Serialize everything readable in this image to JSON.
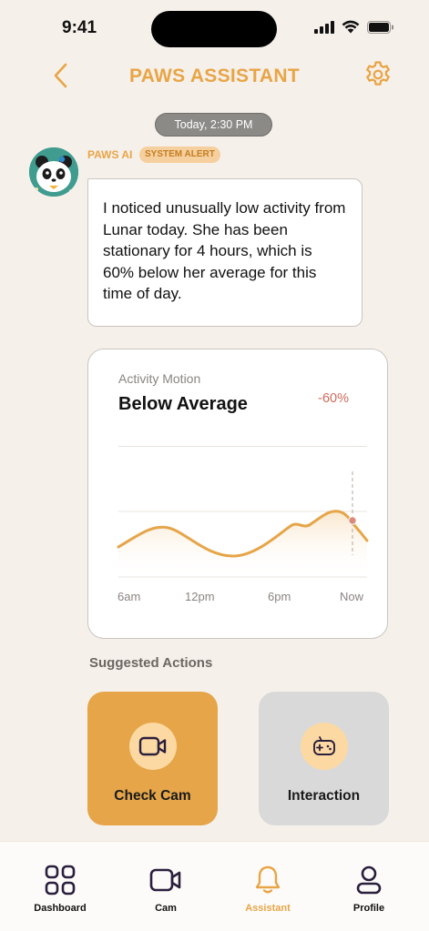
{
  "status_bar": {
    "time": "9:41"
  },
  "header": {
    "title": "PAWS ASSISTANT"
  },
  "timestamp": "Today, 2:30 PM",
  "message": {
    "sender": "PAWS AI",
    "badge": "SYSTEM ALERT",
    "text": "I noticed unusually low activity from Lunar today. She has been stationary for 4 hours, which is 60% below her average for this time of day."
  },
  "activity_card": {
    "label": "Activity Motion",
    "value": "Below Average",
    "delta": "-60%",
    "accent_color": "#e5a548",
    "marker_color": "#d98a7a",
    "x_labels": [
      "6am",
      "12pm",
      "6pm",
      "Now"
    ]
  },
  "suggested": {
    "title": "Suggested Actions",
    "actions": [
      {
        "label": "Check Cam",
        "icon": "video-camera-icon"
      },
      {
        "label": "Interaction",
        "icon": "gamepad-icon"
      }
    ]
  },
  "nav": {
    "items": [
      {
        "label": "Dashboard",
        "icon": "grid-icon"
      },
      {
        "label": "Cam",
        "icon": "video-camera-icon"
      },
      {
        "label": "Assistant",
        "icon": "bell-icon",
        "active": true
      },
      {
        "label": "Profile",
        "icon": "person-icon"
      }
    ]
  },
  "colors": {
    "brand": "#e8a546",
    "background": "#f6f0ea",
    "dark_icon": "#2a1f3d"
  }
}
